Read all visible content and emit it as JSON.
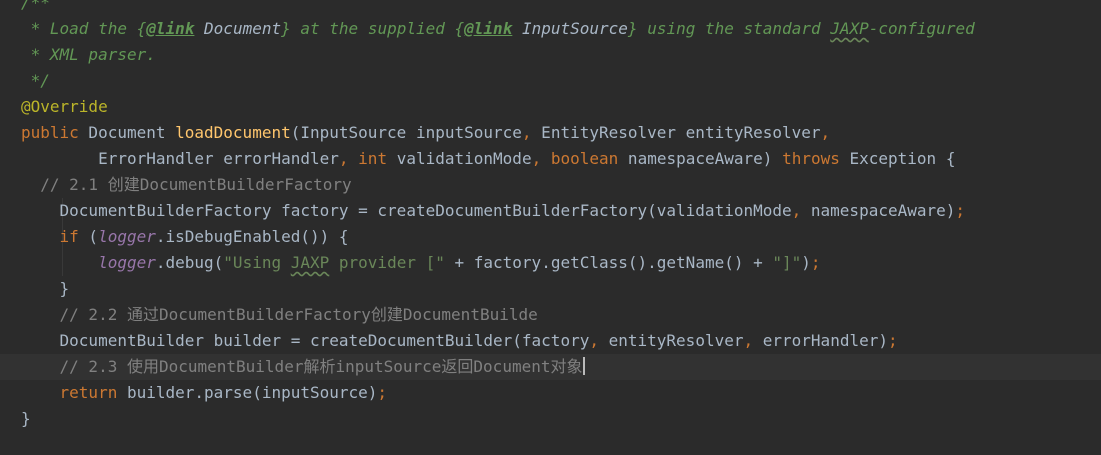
{
  "editor": {
    "lines": [
      [
        {
          "t": "/**",
          "c": "doc"
        }
      ],
      [
        {
          "t": " * Load the ",
          "c": "doc"
        },
        {
          "t": "{",
          "c": "doc"
        },
        {
          "t": "@link",
          "c": "doctag"
        },
        {
          "t": " Document",
          "c": "docref"
        },
        {
          "t": "}",
          "c": "doc"
        },
        {
          "t": " at the supplied ",
          "c": "doc"
        },
        {
          "t": "{",
          "c": "doc"
        },
        {
          "t": "@link",
          "c": "doctag"
        },
        {
          "t": " InputSource",
          "c": "docref"
        },
        {
          "t": "}",
          "c": "doc"
        },
        {
          "t": " using the standard ",
          "c": "doc"
        },
        {
          "t": "JAXP",
          "c": "doc typo"
        },
        {
          "t": "-configured",
          "c": "doc"
        }
      ],
      [
        {
          "t": " * XML parser.",
          "c": "doc"
        }
      ],
      [
        {
          "t": " */",
          "c": "doc"
        }
      ],
      [
        {
          "t": "@Override",
          "c": "ann"
        }
      ],
      [
        {
          "t": "public",
          "c": "kw"
        },
        {
          "t": " Document ",
          "c": ""
        },
        {
          "t": "loadDocument",
          "c": "fn"
        },
        {
          "t": "(InputSource inputSource",
          "c": ""
        },
        {
          "t": ",",
          "c": "kw"
        },
        {
          "t": " EntityResolver entityResolver",
          "c": ""
        },
        {
          "t": ",",
          "c": "kw"
        }
      ],
      [
        {
          "t": "        ErrorHandler errorHandler",
          "c": ""
        },
        {
          "t": ",",
          "c": "kw"
        },
        {
          "t": " ",
          "c": ""
        },
        {
          "t": "int",
          "c": "kw"
        },
        {
          "t": " validationMode",
          "c": ""
        },
        {
          "t": ",",
          "c": "kw"
        },
        {
          "t": " ",
          "c": ""
        },
        {
          "t": "boolean",
          "c": "kw"
        },
        {
          "t": " namespaceAware) ",
          "c": ""
        },
        {
          "t": "throws",
          "c": "kw"
        },
        {
          "t": " Exception {",
          "c": ""
        }
      ],
      [
        {
          "t": "  // 2.1 创建DocumentBuilderFactory",
          "c": "cmt"
        }
      ],
      [
        {
          "t": "    DocumentBuilderFactory factory = createDocumentBuilderFactory(validationMode",
          "c": ""
        },
        {
          "t": ",",
          "c": "kw"
        },
        {
          "t": " namespaceAware)",
          "c": ""
        },
        {
          "t": ";",
          "c": "kw"
        }
      ],
      [
        {
          "t": "    ",
          "c": ""
        },
        {
          "t": "if",
          "c": "kw"
        },
        {
          "t": " (",
          "c": ""
        },
        {
          "t": "logger",
          "c": "field"
        },
        {
          "t": ".isDebugEnabled()) {",
          "c": ""
        }
      ],
      [
        {
          "t": "        ",
          "c": ""
        },
        {
          "t": "logger",
          "c": "field"
        },
        {
          "t": ".debug(",
          "c": ""
        },
        {
          "t": "\"Using ",
          "c": "str"
        },
        {
          "t": "JAXP",
          "c": "str typo"
        },
        {
          "t": " provider [\"",
          "c": "str"
        },
        {
          "t": " + factory.getClass().getName() + ",
          "c": ""
        },
        {
          "t": "\"]\"",
          "c": "str"
        },
        {
          "t": ")",
          "c": ""
        },
        {
          "t": ";",
          "c": "kw"
        }
      ],
      [
        {
          "t": "    }",
          "c": ""
        }
      ],
      [
        {
          "t": "    // 2.2 通过DocumentBuilderFactory创建DocumentBuilde",
          "c": "cmt"
        }
      ],
      [
        {
          "t": "    DocumentBuilder builder = createDocumentBuilder(factory",
          "c": ""
        },
        {
          "t": ",",
          "c": "kw"
        },
        {
          "t": " entityResolver",
          "c": ""
        },
        {
          "t": ",",
          "c": "kw"
        },
        {
          "t": " errorHandler)",
          "c": ""
        },
        {
          "t": ";",
          "c": "kw"
        }
      ],
      [
        {
          "t": "    // 2.3 使用DocumentBuilder解析inputSource返回Document对象",
          "c": "cmt"
        }
      ],
      [
        {
          "t": "    ",
          "c": ""
        },
        {
          "t": "return",
          "c": "kw"
        },
        {
          "t": " builder.parse(inputSource)",
          "c": ""
        },
        {
          "t": ";",
          "c": "kw"
        }
      ],
      [
        {
          "t": "}",
          "c": ""
        }
      ]
    ]
  }
}
